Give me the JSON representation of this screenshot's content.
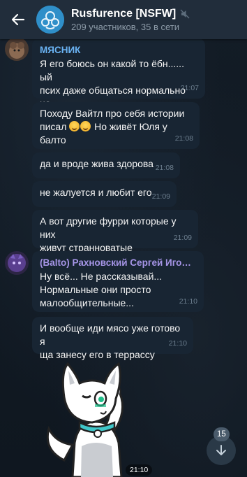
{
  "header": {
    "title": "Rusfurence [NSFW]",
    "subtitle": "209 участников, 35 в сети",
    "back_icon": "arrow-left-icon",
    "mute_icon": "muted-speaker-icon"
  },
  "colors": {
    "header_bg": "#212d3b",
    "bubble_bg": "#182533",
    "sender_1": "#6ab3f3",
    "sender_2": "#a695e7"
  },
  "messages": [
    {
      "sender": "МЯСНИК",
      "text": "Я его боюсь он какой то ёбн...... ый\nпсих даже общаться нормально не\nможет",
      "time": "21:07"
    },
    {
      "text_before": "Походу Вайтл про себя истории\nписал ",
      "text_after": " Но живёт Юля у балто",
      "emoji": "grinning-sweat-emoji",
      "time": "21:08"
    },
    {
      "text": "да и вроде жива здорова",
      "time": "21:08"
    },
    {
      "text": "не жалуется и любит его",
      "time": "21:09"
    },
    {
      "text": "А вот другие фурри которые у них\nживут странноватые",
      "time": "21:09"
    },
    {
      "sender": "(Balto) Рахновский Сергей Игоревич",
      "text": "Ну всё... Не рассказывай...\nНормальные они просто\nмалообщительные...",
      "time": "21:10"
    },
    {
      "text": "И вообще иди мясо уже готово я\nща занесу его в террассу",
      "time": "21:10"
    },
    {
      "sticker": "white-cat-furry-sticker",
      "time": "21:10"
    }
  ],
  "scroll": {
    "unread_count": "15",
    "icon": "arrow-down-icon"
  }
}
